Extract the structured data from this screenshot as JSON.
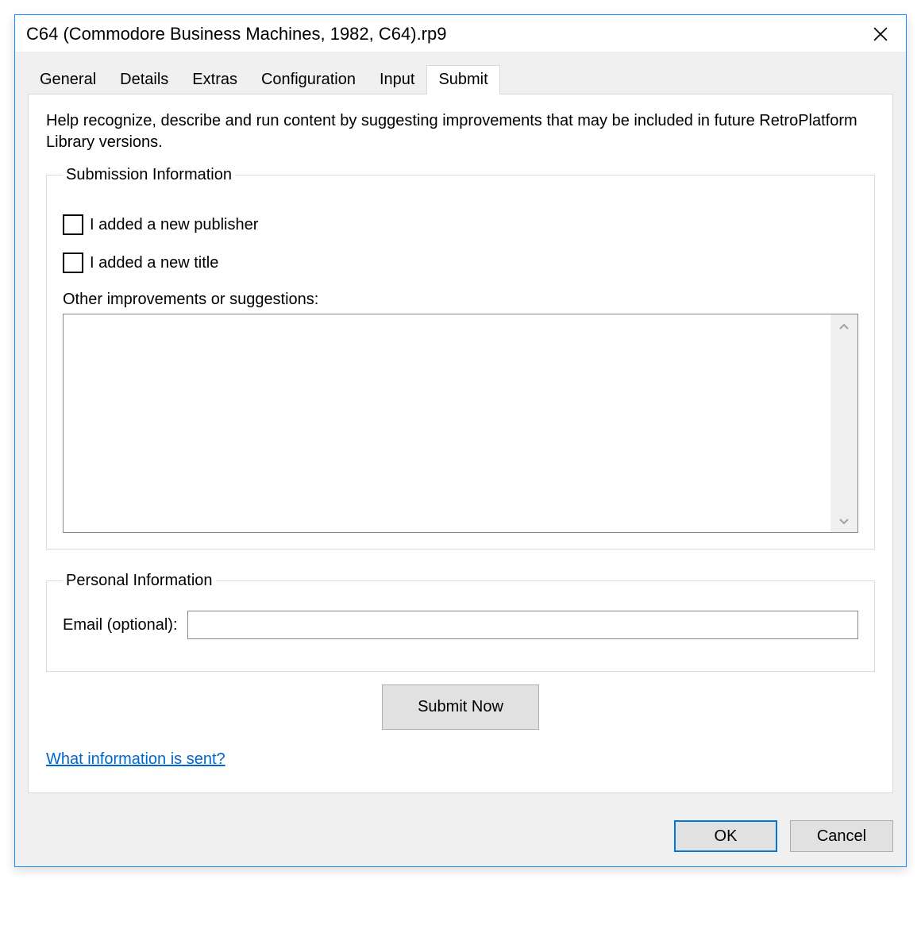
{
  "window": {
    "title": "C64 (Commodore Business Machines, 1982, C64).rp9"
  },
  "tabs": [
    {
      "label": "General",
      "active": false
    },
    {
      "label": "Details",
      "active": false
    },
    {
      "label": "Extras",
      "active": false
    },
    {
      "label": "Configuration",
      "active": false
    },
    {
      "label": "Input",
      "active": false
    },
    {
      "label": "Submit",
      "active": true
    }
  ],
  "content": {
    "intro": "Help recognize, describe and run content by suggesting improvements that may be included in future RetroPlatform Library versions.",
    "submission": {
      "legend": "Submission Information",
      "checkbox_publisher": "I added a new publisher",
      "checkbox_title": "I added a new title",
      "other_label": "Other improvements or suggestions:",
      "other_value": ""
    },
    "personal": {
      "legend": "Personal Information",
      "email_label": "Email (optional):",
      "email_value": ""
    },
    "submit_button": "Submit Now",
    "info_link": "What information is sent?"
  },
  "buttons": {
    "ok": "OK",
    "cancel": "Cancel"
  }
}
